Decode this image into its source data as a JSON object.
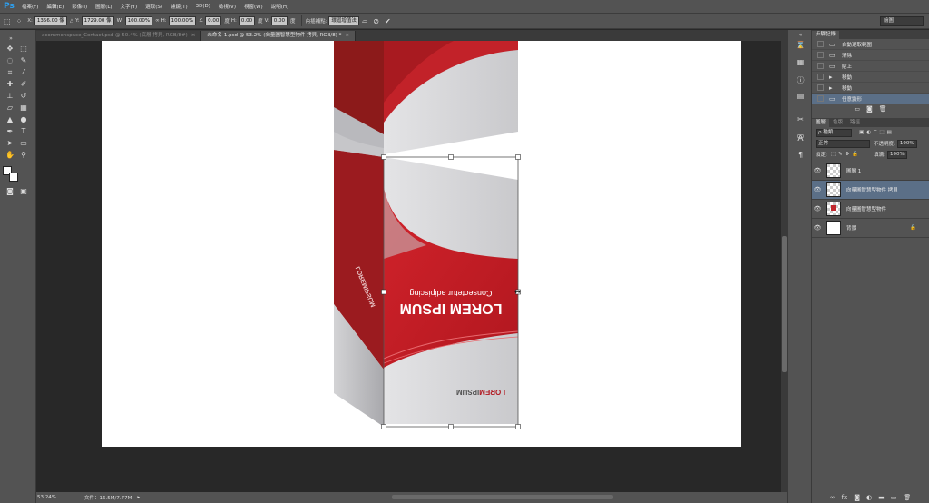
{
  "app": {
    "logo": "Ps"
  },
  "menu": [
    "檔案(F)",
    "編輯(E)",
    "影像(I)",
    "圖層(L)",
    "文字(Y)",
    "選取(S)",
    "濾鏡(T)",
    "3D(D)",
    "檢視(V)",
    "視窗(W)",
    "說明(H)"
  ],
  "options": {
    "x_label": "X:",
    "x_value": "1356.00 像",
    "y_label": "Y:",
    "y_value": "1729.00 像",
    "w_label": "W:",
    "w_value": "100.00%",
    "h_label": "H:",
    "h_value": "100.00%",
    "angle_value": "0.00",
    "angle_unit": "度",
    "hskew_label": "H:",
    "hskew_value": "0.00",
    "hskew_unit": "度",
    "vskew_label": "V:",
    "vskew_value": "0.00",
    "vskew_unit": "度",
    "interp_label": "內插補點:",
    "interp_value": "環迴增值法",
    "workspace": "繪圖"
  },
  "tabs": [
    {
      "label": "acommonspace_Contact.psd @ 50.4% (底層 拷貝, RGB/8#)"
    },
    {
      "label": "未命名-1.psd @ 53.2% (向量圖智慧型物件 拷貝, RGB/8) *"
    }
  ],
  "status": {
    "zoom": "53.24%",
    "doc": "文件：16.5M/7.77M"
  },
  "artwork": {
    "title": "LOREM IPSUM",
    "subtitle": "Consectetur adipiscing",
    "logo_a": "LOREM",
    "logo_b": "IPSUM",
    "brand": "#c1272d"
  },
  "history": {
    "tabs": [
      "步驟記錄"
    ],
    "items": [
      {
        "label": "自動選取範圍"
      },
      {
        "label": "清除"
      },
      {
        "label": "貼上"
      },
      {
        "label": "移動"
      },
      {
        "label": "移動"
      },
      {
        "label": "任意變形"
      }
    ]
  },
  "layers_panel": {
    "tabs": [
      "圖層",
      "色版",
      "路徑"
    ],
    "filter": "種類",
    "blend_mode": "正常",
    "opacity_label": "不透明度:",
    "opacity": "100%",
    "lock_label": "鎖定:",
    "fill_label": "填滿:",
    "fill": "100%",
    "layers": [
      {
        "name": "圖層 1"
      },
      {
        "name": "向量圖智慧型物件 拷貝"
      },
      {
        "name": "向量圖智慧型物件"
      },
      {
        "name": "背景"
      }
    ]
  }
}
